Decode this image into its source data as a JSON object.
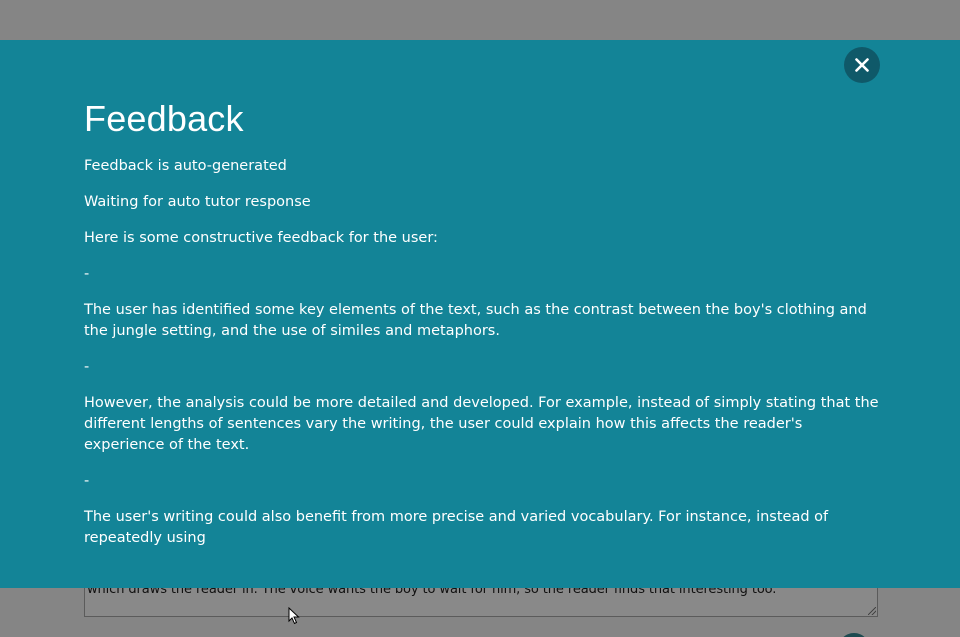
{
  "background": {
    "textarea_text": "which draws the reader in. The voice wants the boy to wait for him, so the reader finds that interesting too."
  },
  "modal": {
    "title": "Feedback",
    "close_icon": "close-icon",
    "lines": [
      "Feedback is auto-generated",
      "Waiting for auto tutor response",
      "Here is some constructive feedback for the user:",
      "-",
      "The user has identified some key elements of the text, such as the contrast between the boy's clothing and the jungle setting, and the use of similes and metaphors.",
      "-",
      "However, the analysis could be more detailed and developed. For example, instead of simply stating that the different lengths of sentences vary the writing, the user could explain how this affects the reader's experience of the text.",
      "-",
      "The user's writing could also benefit from more precise and varied vocabulary. For instance, instead of repeatedly using"
    ]
  },
  "colors": {
    "modal_bg": "#138497",
    "close_bg": "#0f5969",
    "overlay": "#858585"
  }
}
